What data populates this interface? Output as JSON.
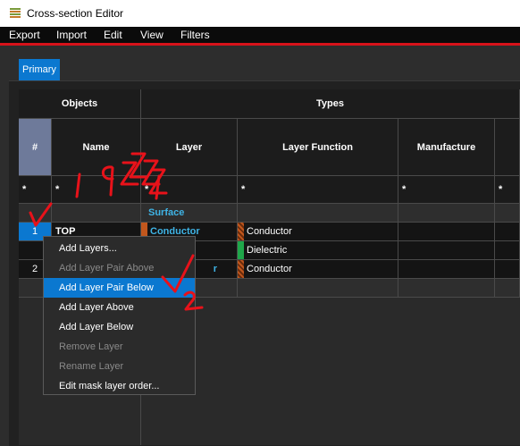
{
  "window": {
    "title": "Cross-section Editor"
  },
  "menubar": {
    "items": [
      "Export",
      "Import",
      "Edit",
      "View",
      "Filters"
    ]
  },
  "tabs": {
    "primary": "Primary"
  },
  "table": {
    "group_headers": {
      "objects": "Objects",
      "types": "Types"
    },
    "columns": {
      "num": "#",
      "name": "Name",
      "layer": "Layer",
      "layer_function": "Layer Function",
      "manufacture": "Manufacture"
    },
    "filter_value": "*",
    "rows": {
      "surface": {
        "layer": "Surface"
      },
      "top": {
        "num": "1",
        "name": "TOP",
        "layer": "Conductor",
        "function": "Conductor"
      },
      "dielectric": {
        "function": "Dielectric"
      },
      "row2": {
        "num": "2",
        "layer": "r",
        "function": "Conductor"
      }
    }
  },
  "context_menu": {
    "items": [
      {
        "label": "Add Layers...",
        "enabled": true
      },
      {
        "label": "Add Layer Pair Above",
        "enabled": false
      },
      {
        "label": "Add Layer Pair Below",
        "enabled": true,
        "highlighted": true
      },
      {
        "label": "Add Layer Above",
        "enabled": true
      },
      {
        "label": "Add Layer Below",
        "enabled": true
      },
      {
        "label": "Remove Layer",
        "enabled": false
      },
      {
        "label": "Rename Layer",
        "enabled": false
      },
      {
        "label": "Edit mask layer order...",
        "enabled": true
      }
    ]
  },
  "colors": {
    "accent": "#0b78d0",
    "menubar_bg": "#0b0b0b",
    "red_rule": "#d7121a",
    "conductor_text": "#3fb4e6",
    "dielectric_bar": "#1fa64a",
    "annotation": "#e8121a"
  }
}
